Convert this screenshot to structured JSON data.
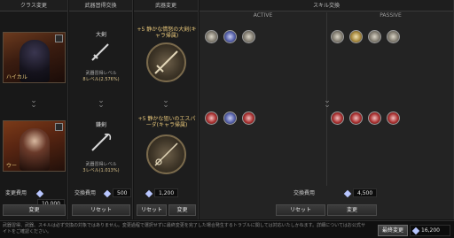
{
  "headers": {
    "class_change": "クラス変更",
    "weapon_mastery_swap": "武器習得交換",
    "weapon_change": "武器変更",
    "skill_swap": "スキル交換"
  },
  "class_panel": {
    "char_top_name": "ハイカル",
    "char_bottom_name": "ウー",
    "cost_label": "変更費用",
    "cost_value": "10,000",
    "change_button": "変更"
  },
  "mastery_panel": {
    "top_weapon": "大剣",
    "top_level_label": "武器習得レベル",
    "top_level_value": "8レベル(2.576%)",
    "bottom_weapon": "鎌剣",
    "bottom_level_label": "武器習得レベル",
    "bottom_level_value": "3レベル(1.013%)",
    "cost_label": "交換費用",
    "cost_value": "500",
    "reset_button": "リセット"
  },
  "weapon_panel": {
    "top_title": "+5 静かな情怒の大剣(キャラ帰属)",
    "bottom_title": "+5 静かな狙いのエスパーダ(キャラ帰属)",
    "cost_value": "1,200",
    "reset_button": "リセット",
    "change_button": "変更"
  },
  "skill_panel": {
    "active_label": "ACTIVE",
    "passive_label": "PASSIVE",
    "active_top": [
      {
        "icon": "wing-skill-icon",
        "style": "plain"
      },
      {
        "icon": "star-skill-icon",
        "style": "blue"
      },
      {
        "icon": "bird-skill-icon",
        "style": "plain"
      }
    ],
    "passive_top": [
      {
        "icon": "swirl-skill-icon",
        "style": "plain"
      },
      {
        "icon": "feather-skill-icon",
        "style": "gold"
      },
      {
        "icon": "blade-skill-icon",
        "style": "plain"
      },
      {
        "icon": "shield-skill-icon",
        "style": "plain"
      }
    ],
    "active_bottom": [
      {
        "icon": "slash-skill-icon",
        "style": "red"
      },
      {
        "icon": "burst-skill-icon",
        "style": "blue"
      },
      {
        "icon": "fang-skill-icon",
        "style": "red"
      }
    ],
    "passive_bottom": [
      {
        "icon": "flame-skill-icon",
        "style": "red"
      },
      {
        "icon": "gem-skill-icon",
        "style": "red"
      },
      {
        "icon": "claw-skill-icon",
        "style": "red"
      },
      {
        "icon": "heart-skill-icon",
        "style": "red"
      }
    ],
    "cost_label": "交換費用",
    "cost_value": "4,500",
    "reset_button": "リセット",
    "change_button": "変更"
  },
  "footer": {
    "note": "武器習得、武器、スキルは必ず交換の対象ではありません。変更過程で選択せずに最終変更を完了した場合発生するトラブルに関しては対応いたしかねます。詳細についてはお公式サイトをご確認ください。",
    "final_change_button": "最終変更",
    "final_cost_value": "16,200"
  },
  "colors": {
    "accent_gold": "#e8c77a",
    "gem_blue": "#b8c6ff"
  }
}
